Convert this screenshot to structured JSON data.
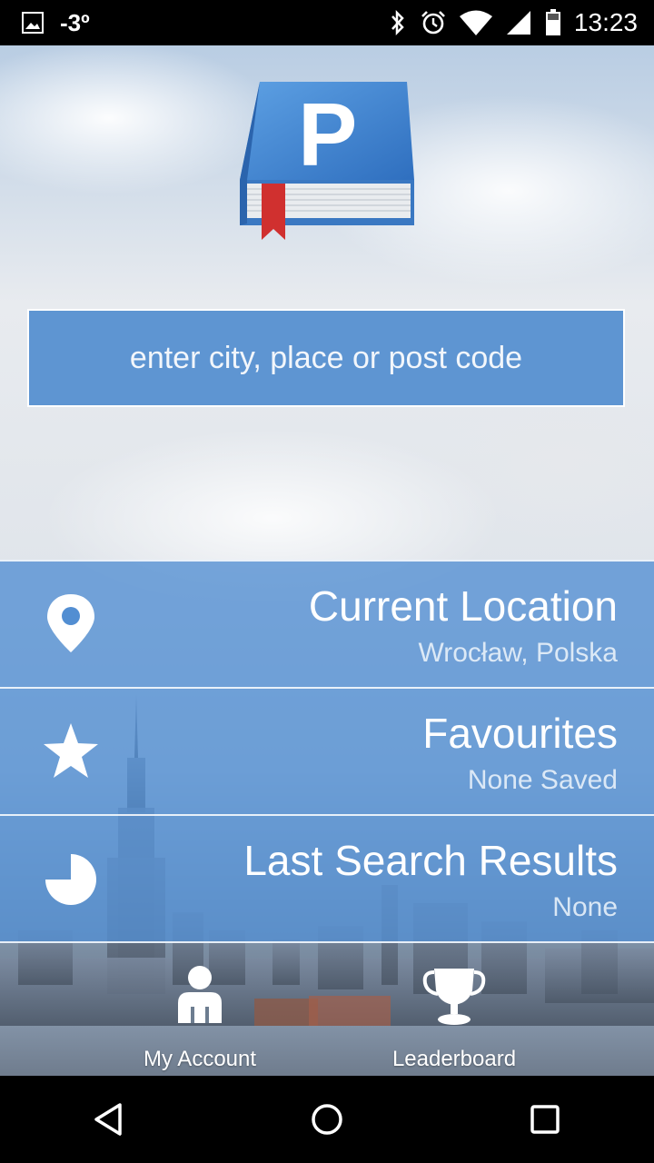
{
  "status_bar": {
    "temperature": "-3º",
    "time": "13:23",
    "icons": [
      "image-icon",
      "bluetooth-icon",
      "alarm-icon",
      "wifi-icon",
      "signal-icon",
      "battery-icon"
    ]
  },
  "logo": {
    "icon": "parking-book-logo",
    "letter": "P"
  },
  "search": {
    "placeholder": "enter city, place or post code"
  },
  "menu": [
    {
      "icon": "location-pin-icon",
      "title": "Current Location",
      "subtitle": "Wrocław, Polska"
    },
    {
      "icon": "star-icon",
      "title": "Favourites",
      "subtitle": "None Saved"
    },
    {
      "icon": "pie-chart-icon",
      "title": "Last Search Results",
      "subtitle": "None"
    }
  ],
  "bottom_nav": [
    {
      "icon": "person-icon",
      "label": "My Account"
    },
    {
      "icon": "trophy-icon",
      "label": "Leaderboard"
    }
  ],
  "system_nav": [
    "back-icon",
    "home-icon",
    "recents-icon"
  ],
  "colors": {
    "accent_blue": "#5e95d2",
    "row_blue": "#528ed2",
    "logo_red": "#d0302f"
  }
}
